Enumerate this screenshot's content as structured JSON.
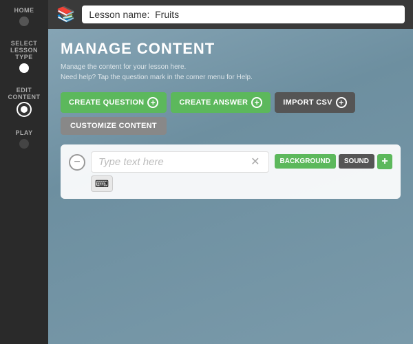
{
  "sidebar": {
    "items": [
      {
        "label": "HOME",
        "state": "dot"
      },
      {
        "label": "SELECT\nLESSON\nTYPE",
        "state": "dot-active"
      },
      {
        "label": "EDIT\nCONTENT",
        "state": "dot-ring"
      },
      {
        "label": "PLAY",
        "state": "dot-inactive"
      }
    ]
  },
  "topbar": {
    "icon": "📚",
    "lesson_label": "Lesson name:",
    "lesson_name": "Fruits"
  },
  "page": {
    "title": "MANAGE CONTENT",
    "subtitle_line1": "Manage the content for your lesson here.",
    "subtitle_line2": "Need help? Tap the question mark in the corner menu for Help."
  },
  "toolbar": {
    "create_question": "CREATE QUESTION",
    "create_answer": "CREATE ANSWER",
    "import_csv": "IMPORT CSV",
    "customize_content": "CUSTOMIZE CONTENT"
  },
  "content_card": {
    "text_placeholder": "Type text here",
    "background_label": "BACKGROUND",
    "sound_label": "SOUND"
  }
}
